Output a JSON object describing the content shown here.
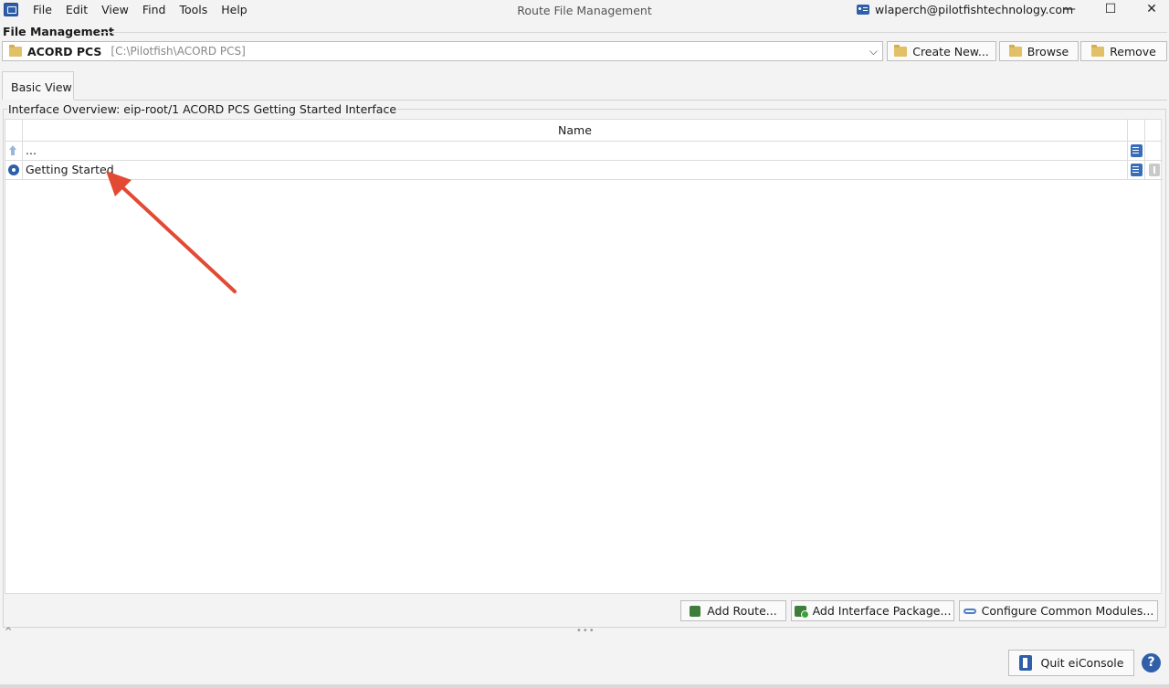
{
  "menubar": {
    "items": [
      "File",
      "Edit",
      "View",
      "Find",
      "Tools",
      "Help"
    ],
    "window_title": "Route File Management",
    "account": "wlaperch@pilotfishtechnology.com",
    "controls": {
      "minimize": "—",
      "maximize": "☐",
      "close": "✕"
    }
  },
  "file_management": {
    "label": "File Management",
    "selected_project": "ACORD PCS",
    "selected_path": "[C:\\Pilotfish\\ACORD PCS]",
    "dropdown_arrow": "⌵",
    "buttons": {
      "create": "Create New...",
      "browse": "Browse",
      "remove": "Remove"
    }
  },
  "tabs": {
    "basic_view": "Basic View"
  },
  "interface_overview": {
    "title": "Interface Overview: eip-root/1 ACORD PCS Getting Started Interface",
    "column_name": "Name",
    "rows": [
      {
        "name": "..."
      },
      {
        "name": "Getting Started"
      }
    ]
  },
  "bottom_buttons": {
    "add_route": "Add Route...",
    "add_package": "Add Interface Package...",
    "configure_modules": "Configure Common Modules..."
  },
  "footer": {
    "collapse_arrow": "^",
    "splitter_dots": "•••",
    "quit": "Quit eiConsole",
    "help": "?"
  },
  "colors": {
    "accent": "#2f5fa8",
    "annotation_arrow": "#e24a33",
    "folder": "#e2c068",
    "module_green": "#3e7d3a"
  }
}
